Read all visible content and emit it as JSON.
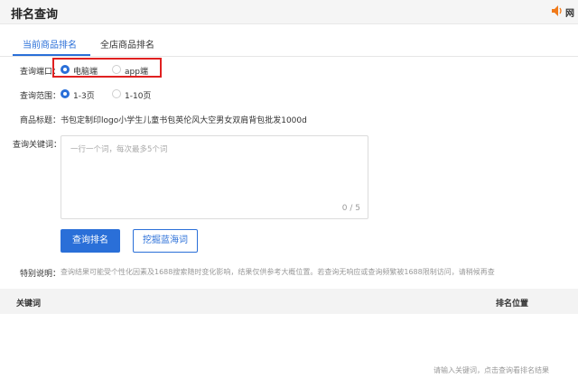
{
  "header": {
    "title": "排名查询",
    "right_text": "网"
  },
  "tabs": [
    {
      "label": "当前商品排名"
    },
    {
      "label": "全店商品排名"
    }
  ],
  "form": {
    "port": {
      "label": "查询端口：",
      "options": [
        "电脑端",
        "app端"
      ],
      "selected": "电脑端"
    },
    "range": {
      "label": "查询范围：",
      "options": [
        "1-3页",
        "1-10页"
      ],
      "selected": "1-3页"
    },
    "product_title": {
      "label": "商品标题：",
      "value": "书包定制印logo小学生儿童书包英伦风大空男女双肩背包批发1000d"
    },
    "keywords": {
      "label": "查询关键词：",
      "placeholder": "一行一个词，每次最多5个词",
      "counter": "0 / 5"
    }
  },
  "buttons": {
    "query": "查询排名",
    "mine": "挖掘蓝海词"
  },
  "note": {
    "label": "特别说明：",
    "text": "查询结果可能受个性化因素及1688搜索随时变化影响，结果仅供参考大概位置。若查询无响应或查询频繁被1688限制访问，请稍候再查"
  },
  "table": {
    "columns": [
      "关键词",
      "排名位置"
    ],
    "empty_text": "请输入关键词，点击查询看排名结果"
  },
  "colors": {
    "primary": "#2a6fd8",
    "highlight": "#e02020",
    "speaker": "#f07a1a"
  }
}
